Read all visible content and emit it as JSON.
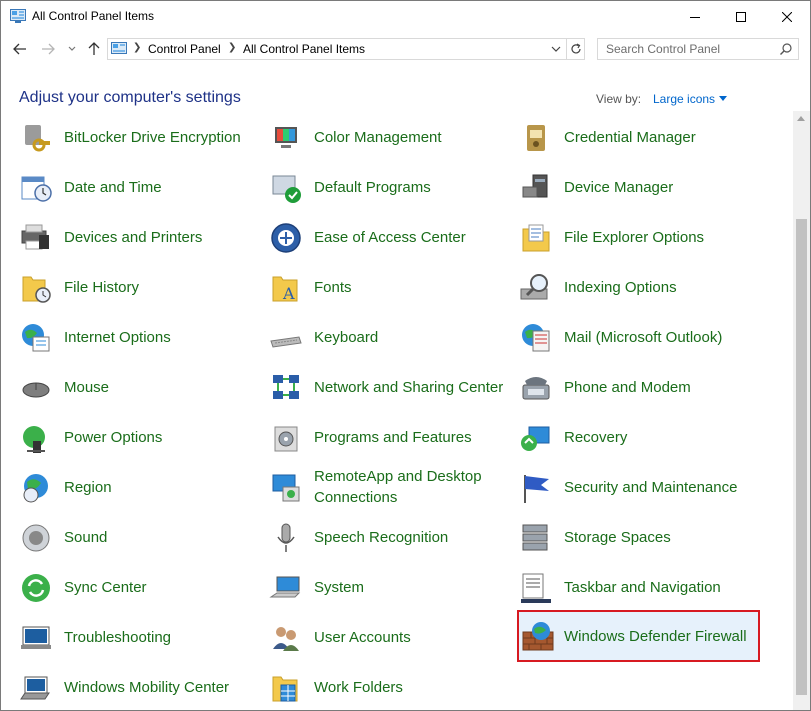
{
  "window": {
    "title": "All Control Panel Items"
  },
  "address": {
    "segments": [
      "Control Panel",
      "All Control Panel Items"
    ]
  },
  "search": {
    "placeholder": "Search Control Panel"
  },
  "header": {
    "heading": "Adjust your computer's settings",
    "view_by_label": "View by:",
    "view_by_value": "Large icons"
  },
  "colors": {
    "link_green": "#1a6d1a",
    "heading_blue": "#1e3287",
    "accent_blue": "#0066cc",
    "selected_border": "#d71a21",
    "selected_bg": "#e6f1fb"
  },
  "items": [
    {
      "label": "BitLocker Drive Encryption",
      "icon": "bitlocker-icon"
    },
    {
      "label": "Color Management",
      "icon": "color-management-icon"
    },
    {
      "label": "Credential Manager",
      "icon": "credential-manager-icon"
    },
    {
      "label": "Date and Time",
      "icon": "date-time-icon"
    },
    {
      "label": "Default Programs",
      "icon": "default-programs-icon"
    },
    {
      "label": "Device Manager",
      "icon": "device-manager-icon"
    },
    {
      "label": "Devices and Printers",
      "icon": "devices-printers-icon"
    },
    {
      "label": "Ease of Access Center",
      "icon": "ease-of-access-icon"
    },
    {
      "label": "File Explorer Options",
      "icon": "file-explorer-options-icon"
    },
    {
      "label": "File History",
      "icon": "file-history-icon"
    },
    {
      "label": "Fonts",
      "icon": "fonts-icon"
    },
    {
      "label": "Indexing Options",
      "icon": "indexing-options-icon"
    },
    {
      "label": "Internet Options",
      "icon": "internet-options-icon"
    },
    {
      "label": "Keyboard",
      "icon": "keyboard-icon"
    },
    {
      "label": "Mail (Microsoft Outlook)",
      "icon": "mail-icon"
    },
    {
      "label": "Mouse",
      "icon": "mouse-icon"
    },
    {
      "label": "Network and Sharing Center",
      "icon": "network-sharing-icon"
    },
    {
      "label": "Phone and Modem",
      "icon": "phone-modem-icon"
    },
    {
      "label": "Power Options",
      "icon": "power-options-icon"
    },
    {
      "label": "Programs and Features",
      "icon": "programs-features-icon"
    },
    {
      "label": "Recovery",
      "icon": "recovery-icon"
    },
    {
      "label": "Region",
      "icon": "region-icon"
    },
    {
      "label": "RemoteApp and Desktop Connections",
      "icon": "remoteapp-icon"
    },
    {
      "label": "Security and Maintenance",
      "icon": "security-maintenance-icon"
    },
    {
      "label": "Sound",
      "icon": "sound-icon"
    },
    {
      "label": "Speech Recognition",
      "icon": "speech-recognition-icon"
    },
    {
      "label": "Storage Spaces",
      "icon": "storage-spaces-icon"
    },
    {
      "label": "Sync Center",
      "icon": "sync-center-icon"
    },
    {
      "label": "System",
      "icon": "system-icon"
    },
    {
      "label": "Taskbar and Navigation",
      "icon": "taskbar-navigation-icon"
    },
    {
      "label": "Troubleshooting",
      "icon": "troubleshooting-icon"
    },
    {
      "label": "User Accounts",
      "icon": "user-accounts-icon"
    },
    {
      "label": "Windows Defender Firewall",
      "icon": "firewall-icon",
      "selected": true
    },
    {
      "label": "Windows Mobility Center",
      "icon": "mobility-center-icon"
    },
    {
      "label": "Work Folders",
      "icon": "work-folders-icon"
    }
  ]
}
